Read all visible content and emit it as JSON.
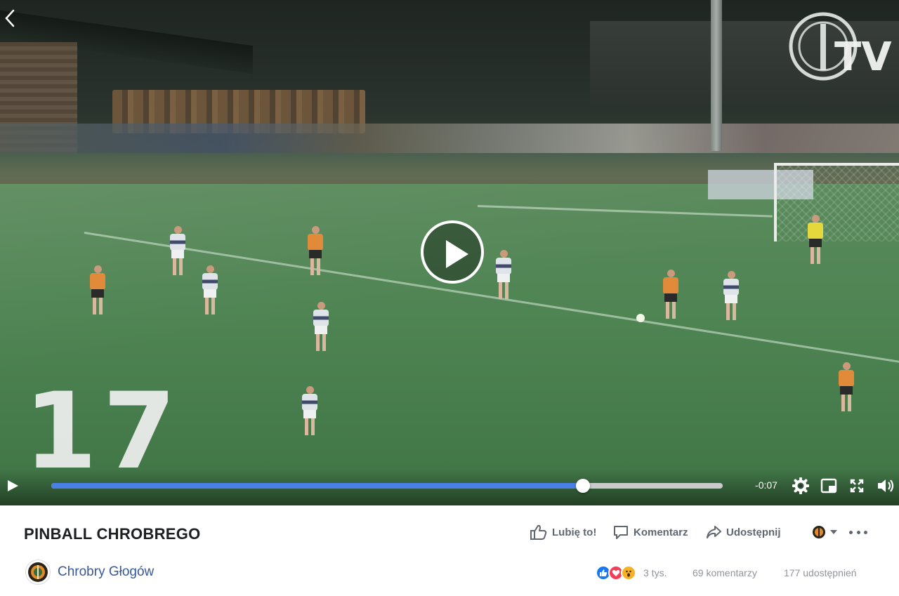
{
  "video": {
    "overlay_number": "17",
    "watermark_text": "TV",
    "time_remaining": "-0:07",
    "progress": 0.792
  },
  "post": {
    "title": "PINBALL CHROBREGO",
    "author": "Chrobry Głogów",
    "actions": {
      "like": "Lubię to!",
      "comment": "Komentarz",
      "share": "Udostępnij"
    },
    "stats": {
      "reactions_count": "3 tys.",
      "comments": "69 komentarzy",
      "shares": "177 udostępnień"
    }
  },
  "colors": {
    "progress_fill": "#4a80e6",
    "link": "#385898",
    "action_text": "#606770"
  }
}
